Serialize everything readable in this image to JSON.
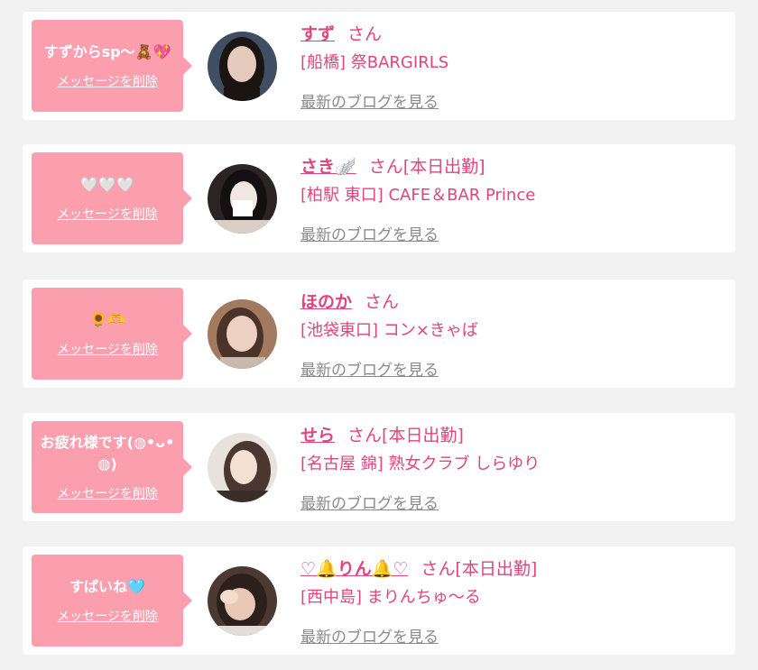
{
  "labels": {
    "delete": "メッセージを削除",
    "blog": "最新のブログを見る",
    "suffix": "さん"
  },
  "cards": [
    {
      "message": "すずからsp〜🧸💖",
      "name": "すず",
      "status": "",
      "shop": "[船橋] 祭BARGIRLS",
      "avatar_tones": [
        "#3f4e62",
        "#e5cbbd",
        "#1b1512"
      ]
    },
    {
      "message": "🤍🤍🤍",
      "name": "さき🪽",
      "status": "[本日出勤]",
      "shop": "[柏駅 東口] CAFE＆BAR Prince",
      "avatar_tones": [
        "#2c2424",
        "#f1e6e2",
        "#141011"
      ]
    },
    {
      "message": "🌻🫶",
      "name": "ほのか",
      "status": "",
      "shop": "[池袋東口] コン×きゃば",
      "avatar_tones": [
        "#a27a60",
        "#eed0c3",
        "#4a3329"
      ]
    },
    {
      "message": "お疲れ様です(◍•ᴗ•◍)",
      "name": "せら",
      "status": "[本日出勤]",
      "shop": "[名古屋 錦] 熟女クラブ しらゆり",
      "avatar_tones": [
        "#e8e2dc",
        "#f4dfd3",
        "#4a3830"
      ]
    },
    {
      "message": "すぱいね🩵",
      "name": "♡🔔りん🔔♡",
      "status": "[本日出勤]",
      "shop": "[西中島] まりんちゅ〜る",
      "avatar_tones": [
        "#4a3a32",
        "#e9c9b6",
        "#2b201b"
      ]
    }
  ]
}
